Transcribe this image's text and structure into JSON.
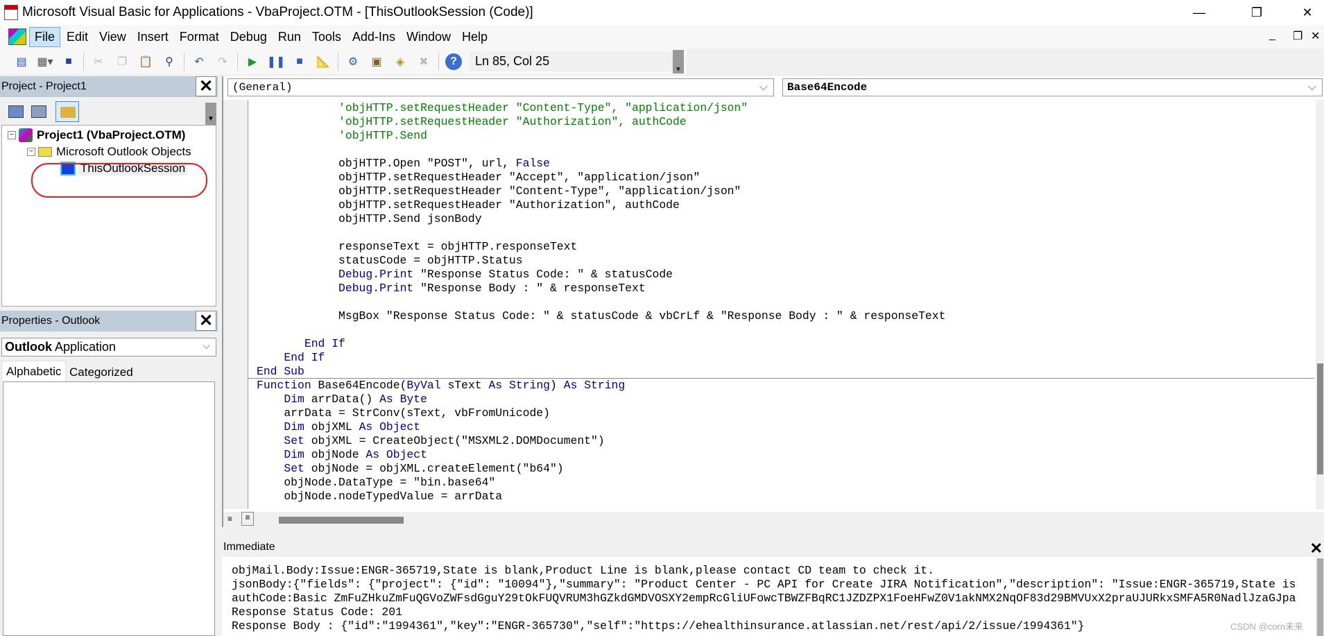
{
  "window": {
    "title": "Microsoft Visual Basic for Applications - VbaProject.OTM - [ThisOutlookSession (Code)]",
    "minimize": "—",
    "restore": "❐",
    "close": "✕"
  },
  "menu": {
    "items": [
      "File",
      "Edit",
      "View",
      "Insert",
      "Format",
      "Debug",
      "Run",
      "Tools",
      "Add-Ins",
      "Window",
      "Help"
    ],
    "mdi": [
      "_",
      "❐",
      "✕"
    ]
  },
  "toolbar": {
    "position": "Ln 85, Col 25"
  },
  "project": {
    "title": "Project - Project1",
    "root": "Project1 (VbaProject.OTM)",
    "folder": "Microsoft Outlook Objects",
    "item": "ThisOutlookSession",
    "close": "✕"
  },
  "properties": {
    "title": "Properties - Outlook",
    "object_bold": "Outlook",
    "object_rest": " Application",
    "tabs": [
      "Alphabetic",
      "Categorized"
    ],
    "close": "✕"
  },
  "code": {
    "object_combo": "(General)",
    "proc_combo": "Base64Encode",
    "lines": [
      [
        [
          "            'objHTTP.setRequestHeader \"Content-Type\", \"application/json\"",
          "c"
        ]
      ],
      [
        [
          "            'objHTTP.setRequestHeader \"Authorization\", authCode",
          "c"
        ]
      ],
      [
        [
          "            'objHTTP.Send",
          "c"
        ]
      ],
      [
        [
          "",
          ""
        ]
      ],
      [
        [
          "            objHTTP.Open \"POST\", url, ",
          ""
        ],
        [
          "False",
          "k"
        ]
      ],
      [
        [
          "            objHTTP.setRequestHeader \"Accept\", \"application/json\"",
          ""
        ]
      ],
      [
        [
          "            objHTTP.setRequestHeader \"Content-Type\", \"application/json\"",
          ""
        ]
      ],
      [
        [
          "            objHTTP.setRequestHeader \"Authorization\", authCode",
          ""
        ]
      ],
      [
        [
          "            objHTTP.Send jsonBody",
          ""
        ]
      ],
      [
        [
          "",
          ""
        ]
      ],
      [
        [
          "            responseText = objHTTP.responseText",
          ""
        ]
      ],
      [
        [
          "            statusCode = objHTTP.Status",
          ""
        ]
      ],
      [
        [
          "            ",
          ""
        ],
        [
          "Debug.Print",
          "k"
        ],
        [
          " \"Response Status Code: \" & statusCode",
          ""
        ]
      ],
      [
        [
          "            ",
          ""
        ],
        [
          "Debug.Print",
          "k"
        ],
        [
          " \"Response Body : \" & responseText",
          ""
        ]
      ],
      [
        [
          "",
          ""
        ]
      ],
      [
        [
          "            MsgBox \"Response Status Code: \" & statusCode & vbCrLf & \"Response Body : \" & responseText",
          ""
        ]
      ],
      [
        [
          "",
          ""
        ]
      ],
      [
        [
          "       End If",
          "k"
        ]
      ],
      [
        [
          "    End If",
          "k"
        ]
      ],
      [
        [
          "End Sub",
          "k"
        ]
      ],
      [
        [
          "Function",
          "k"
        ],
        [
          " Base64Encode(",
          ""
        ],
        [
          "ByVal",
          "k"
        ],
        [
          " sText ",
          ""
        ],
        [
          "As String",
          "k"
        ],
        [
          ") ",
          ""
        ],
        [
          "As String",
          "k"
        ]
      ],
      [
        [
          "    ",
          ""
        ],
        [
          "Dim",
          "k"
        ],
        [
          " arrData() ",
          ""
        ],
        [
          "As Byte",
          "k"
        ]
      ],
      [
        [
          "    arrData = StrConv(sText, vbFromUnicode)",
          ""
        ]
      ],
      [
        [
          "    ",
          ""
        ],
        [
          "Dim",
          "k"
        ],
        [
          " objXML ",
          ""
        ],
        [
          "As Object",
          "k"
        ]
      ],
      [
        [
          "    ",
          ""
        ],
        [
          "Set",
          "k"
        ],
        [
          " objXML = CreateObject(\"MSXML2.DOMDocument\")",
          ""
        ]
      ],
      [
        [
          "    ",
          ""
        ],
        [
          "Dim",
          "k"
        ],
        [
          " objNode ",
          ""
        ],
        [
          "As Object",
          "k"
        ]
      ],
      [
        [
          "    ",
          ""
        ],
        [
          "Set",
          "k"
        ],
        [
          " objNode = objXML.createElement(\"b64\")",
          ""
        ]
      ],
      [
        [
          "    objNode.DataType = \"bin.base64\"",
          ""
        ]
      ],
      [
        [
          "    objNode.nodeTypedValue = arrData",
          ""
        ]
      ]
    ]
  },
  "immediate": {
    "title": "Immediate",
    "lines": [
      "objMail.Body:Issue:ENGR-365719,State is blank,Product Line is blank,please contact CD team to check it.",
      "jsonBody:{\"fields\": {\"project\": {\"id\": \"10094\"},\"summary\": \"Product Center - PC API for Create JIRA Notification\",\"description\": \"Issue:ENGR-365719,State is",
      "authCode:Basic ZmFuZHkuZmFuQGVoZWFsdGguY29tOkFUQVRUM3hGZkdGMDVOSXY2empRcGliUFowcTBWZFBqRC1JZDZPX1FoeHFwZ0V1akNMX2NqOF83d29BMVUxX2praUJURkxSMFA5R0NadlJzaGJpa",
      "Response Status Code: 201",
      "Response Body : {\"id\":\"1994361\",\"key\":\"ENGR-365730\",\"self\":\"https://ehealthinsurance.atlassian.net/rest/api/2/issue/1994361\"}"
    ]
  },
  "watermark": "CSDN @corn未来",
  "colors": {
    "keyword": "#00008b",
    "comment": "#008000",
    "panel_header": "#bfcddb",
    "highlight": "#e02020"
  }
}
